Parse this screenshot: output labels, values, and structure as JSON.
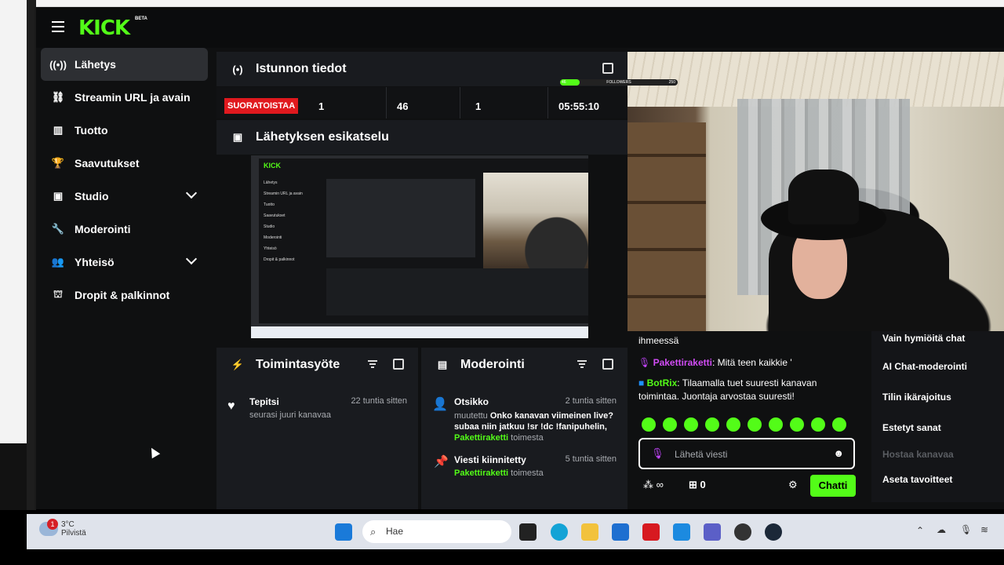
{
  "header": {
    "logo": "KICK",
    "beta": "BETA"
  },
  "sidebar": {
    "items": [
      {
        "label": "Lähetys",
        "icon": "broadcast-icon",
        "active": true
      },
      {
        "label": "Streamin URL ja avain",
        "icon": "link-icon"
      },
      {
        "label": "Tuotto",
        "icon": "chart-icon"
      },
      {
        "label": "Saavutukset",
        "icon": "trophy-icon"
      },
      {
        "label": "Studio",
        "icon": "studio-icon",
        "expandable": true
      },
      {
        "label": "Moderointi",
        "icon": "wrench-icon"
      },
      {
        "label": "Yhteisö",
        "icon": "community-icon",
        "expandable": true
      },
      {
        "label": "Dropit & palkinnot",
        "icon": "drops-icon"
      }
    ]
  },
  "session": {
    "title": "Istunnon tiedot",
    "live": "SUORATOISTAA",
    "stats": [
      "1",
      "46",
      "1",
      "05:55:10"
    ]
  },
  "preview": {
    "title": "Lähetyksen esikatselu"
  },
  "overlay": {
    "left": "46",
    "label": "FOLLOWERS",
    "right": "250"
  },
  "activity": {
    "title": "Toimintasyöte",
    "items": [
      {
        "user": "Tepitsi",
        "action": "seurasi juuri kanavaa",
        "time": "22 tuntia sitten"
      }
    ]
  },
  "moderation": {
    "title": "Moderointi",
    "items": [
      {
        "title": "Otsikko",
        "time": "2 tuntia sitten",
        "prefix": "muutettu",
        "text": "Onko kanavan viimeinen live? subaa niin jatkuu !sr !dc !fanipuhelin,",
        "by": "Pakettiraketti",
        "suffix": "toimesta"
      },
      {
        "title": "Viesti kiinnitetty",
        "time": "5 tuntia sitten",
        "by": "Pakettiraketti",
        "suffix": "toimesta"
      }
    ]
  },
  "chat": {
    "cut_line": "ihmeessä",
    "messages": [
      {
        "user": "Pakettiraketti",
        "text": ": Mitä teen kaikkie '"
      },
      {
        "user": "BotRix",
        "text": ": Tilaamalla tuet suuresti kanavan toimintaa. Juontaja arvostaa suuresti!"
      }
    ],
    "placeholder": "Lähetä viesti",
    "infinity": "∞",
    "gifts": "0",
    "send": "Chatti"
  },
  "quick_actions": [
    "Vain hymiöitä chat",
    "AI Chat-moderointi",
    "Tilin ikärajoitus",
    "Estetyt sanat",
    "Hostaa kanavaa",
    "Aseta tavoitteet"
  ],
  "taskbar": {
    "temp": "3°C",
    "weather": "Pilvistä",
    "badge": "1",
    "search": "Hae"
  },
  "mini": {
    "items": [
      "Lähetys",
      "Streamin URL ja avain",
      "Tuotto",
      "Saavutukset",
      "Studio",
      "Moderointi",
      "Yhteisö",
      "Dropit & palkinnot"
    ]
  },
  "colors": {
    "accent": "#53fc18",
    "live": "#e0191e",
    "bg": "#0f1011",
    "panel": "#191b1f"
  }
}
